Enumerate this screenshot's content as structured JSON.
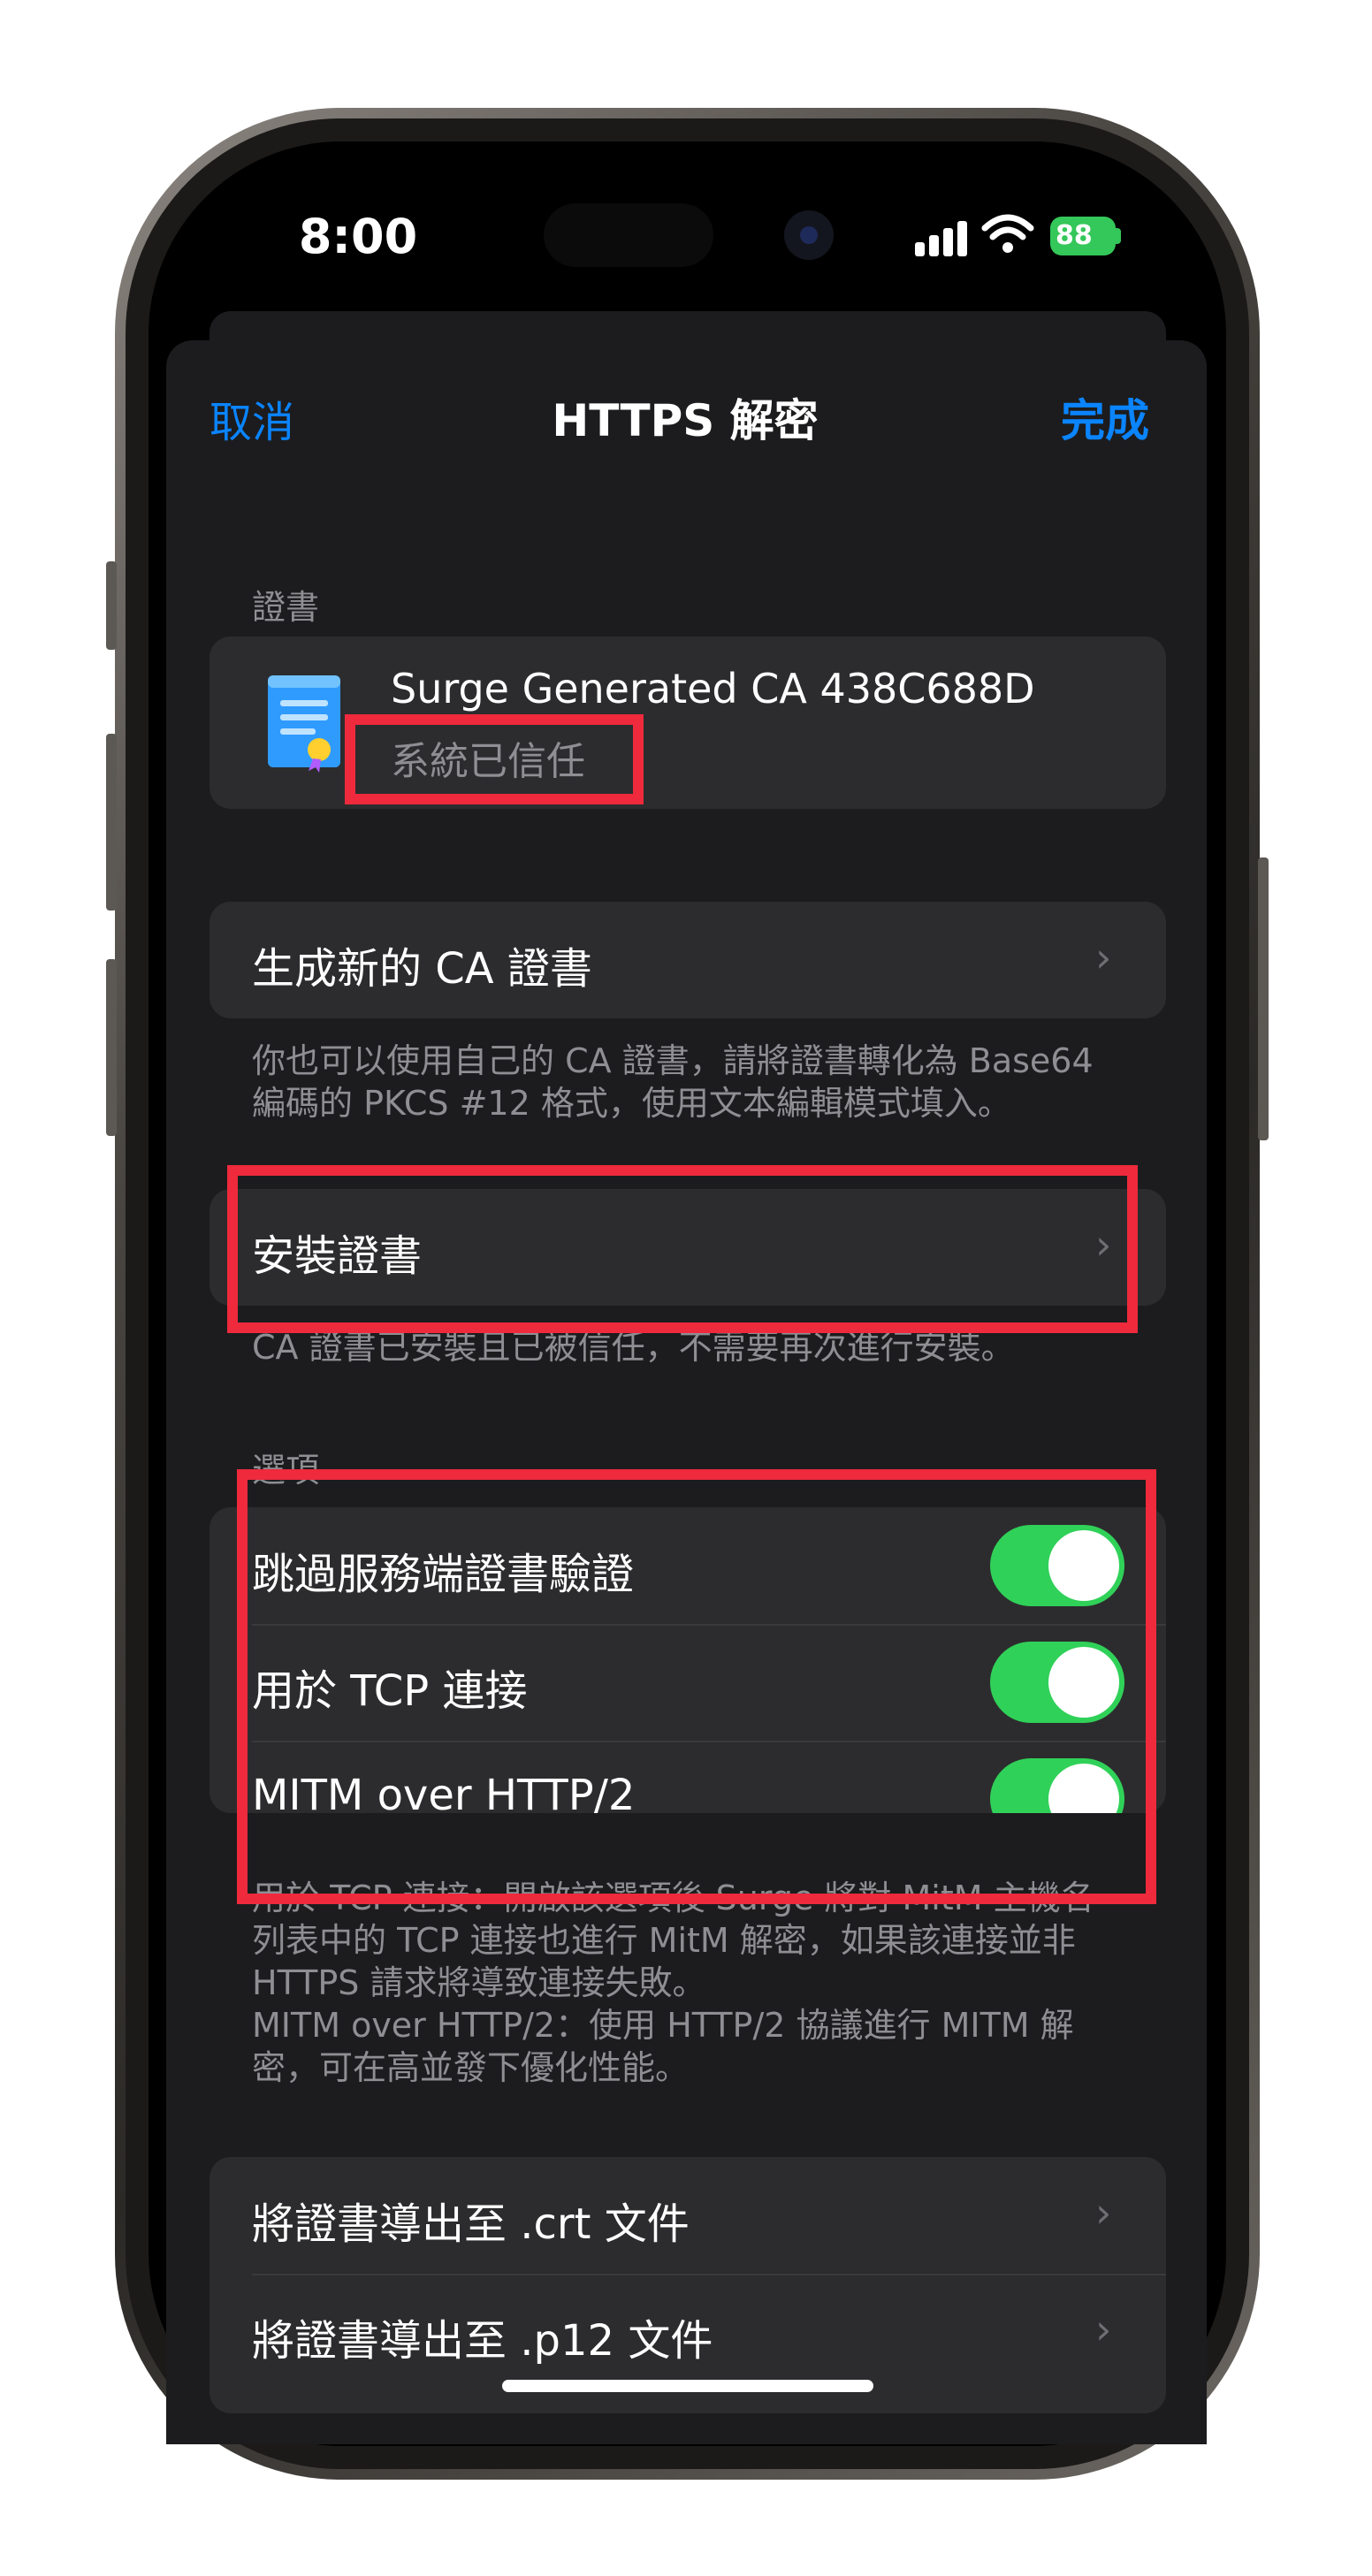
{
  "status_bar": {
    "time": "8:00",
    "battery": "88"
  },
  "nav": {
    "cancel": "取消",
    "title": "HTTPS 解密",
    "done": "完成"
  },
  "certificate": {
    "header": "證書",
    "name": "Surge Generated CA 438C688D",
    "status": "系統已信任"
  },
  "generate": {
    "label": "生成新的 CA 證書",
    "footnote_line1": "你也可以使用自己的 CA 證書，請將證書轉化為 Base64",
    "footnote_line2": "編碼的 PKCS #12 格式，使用文本編輯模式填入。"
  },
  "install": {
    "label": "安裝證書",
    "footnote": "CA 證書已安裝且已被信任，不需要再次進行安裝。"
  },
  "options": {
    "header": "選項",
    "items": [
      {
        "label": "跳過服務端證書驗證",
        "on": true
      },
      {
        "label": "用於 TCP 連接",
        "on": true
      },
      {
        "label": "MITM over HTTP/2",
        "on": true
      }
    ],
    "footnote_line1": "用於 TCP 連接：開啟該選項後 Surge 將對 MitM 主機名",
    "footnote_line2": "列表中的 TCP 連接也進行 MitM 解密，如果該連接並非",
    "footnote_line3": "HTTPS 請求將導致連接失敗。",
    "footnote_line4": "MITM over HTTP/2：使用 HTTP/2 協議進行 MITM 解",
    "footnote_line5": "密，可在高並發下優化性能。"
  },
  "export": {
    "crt": "將證書導出至 .crt 文件",
    "p12": "將證書導出至 .p12 文件"
  },
  "colors": {
    "accent": "#0a84ff",
    "toggle_on": "#30d158",
    "highlight": "#ee2a3c"
  },
  "icons": {
    "certificate": "certificate-icon",
    "chevron": "chevron-right-icon"
  }
}
